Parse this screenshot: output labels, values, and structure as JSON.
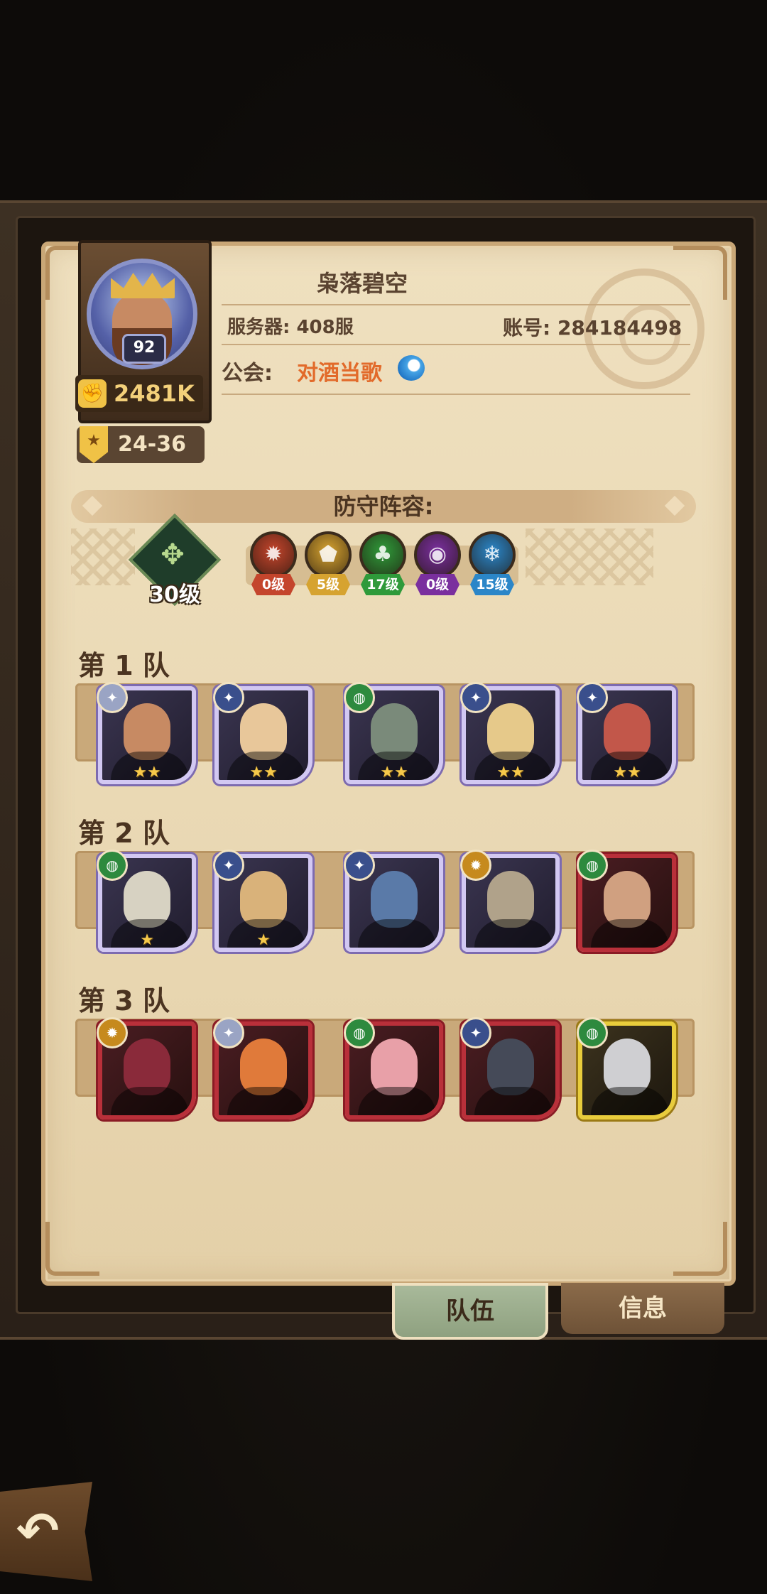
{
  "player": {
    "name": "枭落碧空",
    "level": "92",
    "power": "2481K",
    "rank": "24-36",
    "server": "服务器: 408服",
    "account": "账号: 284184498",
    "guild_label": "公会:",
    "guild_name": "对酒当歌"
  },
  "defense": {
    "title": "防守阵容:",
    "tree_level": "30级",
    "factions": [
      {
        "level": "0级",
        "color": "#c4452c",
        "icon": "fire-faction-icon"
      },
      {
        "level": "5级",
        "color": "#d6a330",
        "icon": "shield-faction-icon"
      },
      {
        "level": "17级",
        "color": "#2f9a3a",
        "icon": "leaf-faction-icon"
      },
      {
        "level": "0级",
        "color": "#7a2f9e",
        "icon": "dark-faction-icon"
      },
      {
        "level": "15级",
        "color": "#2b86c8",
        "icon": "ice-faction-icon"
      }
    ]
  },
  "teams": [
    {
      "label": "第 1 队",
      "heroes": [
        {
          "frame": "purple",
          "stars": "★★",
          "badge": "silver",
          "icon": "hero-king-portrait"
        },
        {
          "frame": "purple",
          "stars": "★★",
          "badge": "blue",
          "icon": "hero-blonde-portrait"
        },
        {
          "frame": "purple",
          "stars": "★★",
          "badge": "green",
          "icon": "hero-hooded-portrait"
        },
        {
          "frame": "purple",
          "stars": "★★",
          "badge": "blue",
          "icon": "hero-bun-portrait"
        },
        {
          "frame": "purple",
          "stars": "★★",
          "badge": "blue",
          "icon": "hero-redhair-portrait"
        }
      ]
    },
    {
      "label": "第 2 队",
      "heroes": [
        {
          "frame": "purple",
          "stars": "★",
          "badge": "green",
          "icon": "hero-armored-portrait"
        },
        {
          "frame": "purple",
          "stars": "★",
          "badge": "blue",
          "icon": "hero-valkyrie-portrait"
        },
        {
          "frame": "purple",
          "stars": "",
          "badge": "blue",
          "icon": "hero-bluehair-portrait"
        },
        {
          "frame": "purple",
          "stars": "",
          "badge": "gold",
          "icon": "hero-helm-portrait"
        },
        {
          "frame": "red",
          "stars": "",
          "badge": "green",
          "icon": "hero-elf-portrait"
        }
      ]
    },
    {
      "label": "第 3 队",
      "heroes": [
        {
          "frame": "red",
          "stars": "",
          "badge": "gold",
          "icon": "hero-catgirl-portrait"
        },
        {
          "frame": "red",
          "stars": "",
          "badge": "silver",
          "icon": "hero-phoenix-portrait"
        },
        {
          "frame": "red",
          "stars": "",
          "badge": "green",
          "icon": "hero-archer-portrait"
        },
        {
          "frame": "red",
          "stars": "",
          "badge": "blue",
          "icon": "hero-knight-portrait"
        },
        {
          "frame": "gold",
          "stars": "",
          "badge": "green",
          "icon": "hero-silverhair-portrait"
        }
      ]
    }
  ],
  "tabs": {
    "team": "队伍",
    "info": "信息"
  },
  "colors": {
    "accent_orange": "#e26a2a",
    "text_brown": "#5a4330",
    "star_gold": "#f6c94a"
  }
}
